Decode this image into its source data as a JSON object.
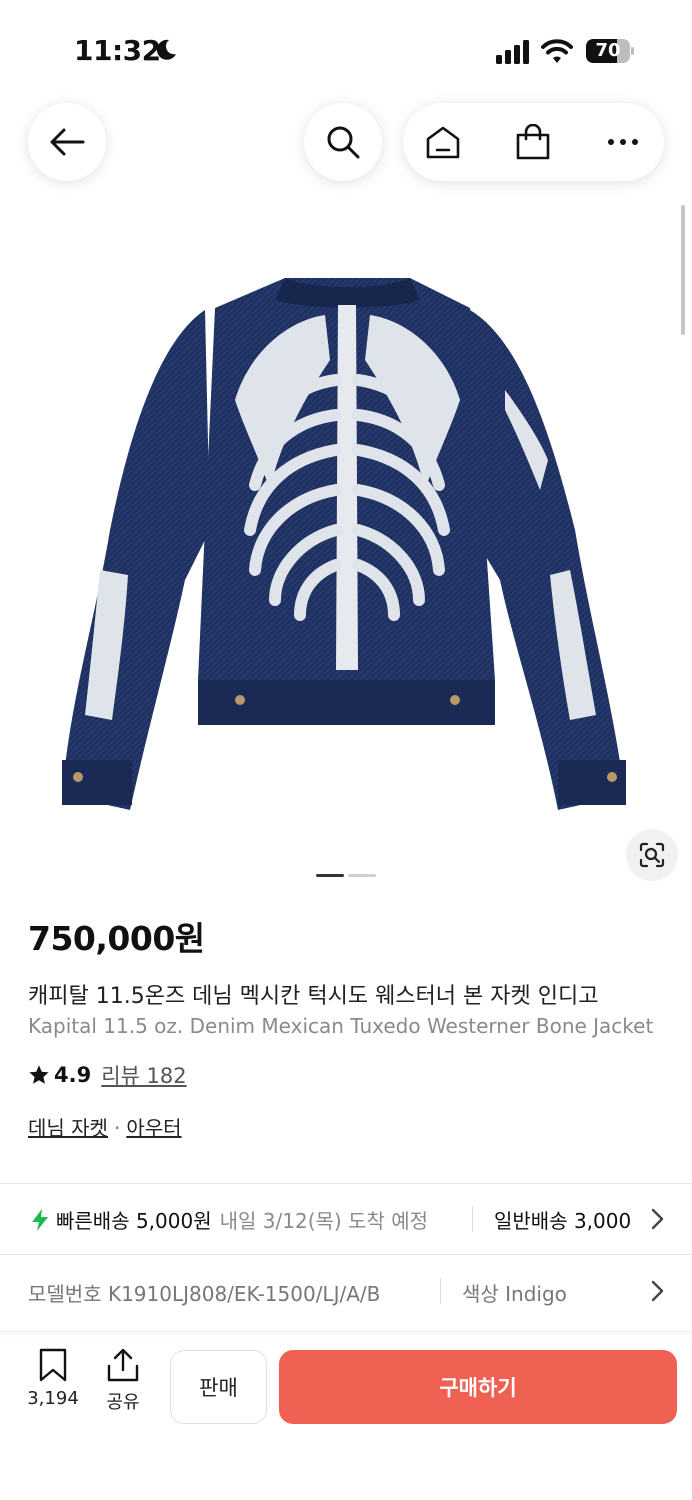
{
  "status_bar": {
    "time": "11:32",
    "battery": "70",
    "battery_level": 0.7
  },
  "nav": {
    "back_icon": "arrow-left-icon",
    "search_icon": "search-icon",
    "home_icon": "home-icon",
    "cart_icon": "shopping-bag-icon",
    "more_icon": "more-icon"
  },
  "product": {
    "image_alt": "skeleton-bone-denim-jacket",
    "image_count": 2,
    "current_image": 1,
    "price": "750,000원",
    "title_ko": "캐피탈 11.5온즈 데님 멕시칸 턱시도 웨스터너 본 자켓 인디고",
    "title_en": "Kapital 11.5 oz. Denim Mexican Tuxedo Westerner Bone Jacket",
    "rating": "4.9",
    "review_label": "리뷰 182",
    "category_primary": "데님 자켓",
    "category_separator": "·",
    "category_secondary": "아우터"
  },
  "shipping": {
    "fast_label": "빠른배송 5,000원",
    "fast_eta": "내일 3/12(목) 도착 예정",
    "normal_label": "일반배송 3,000"
  },
  "model": {
    "model_label": "모델번호 K1910LJ808/EK-1500/LJ/A/B",
    "color_label": "색상 Indigo"
  },
  "bottom_bar": {
    "bookmark_count": "3,194",
    "share_label": "공유",
    "sell_label": "판매",
    "buy_label": "구매하기"
  },
  "colors": {
    "accent": "#ef6253",
    "fast_bolt": "#1db954",
    "denim": "#1f3160"
  }
}
